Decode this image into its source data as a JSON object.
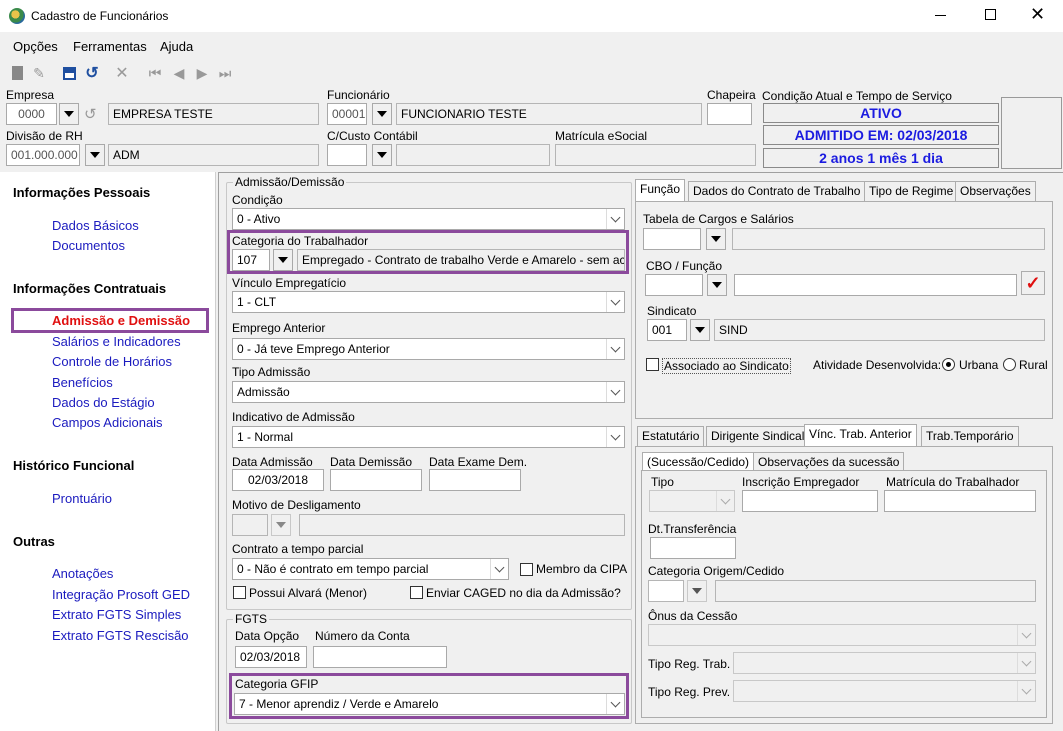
{
  "window": {
    "title": "Cadastro de Funcionários"
  },
  "menu": [
    "Opções",
    "Ferramentas",
    "Ajuda"
  ],
  "header": {
    "empresa_label": "Empresa",
    "empresa_code": "0000",
    "empresa_name": "EMPRESA TESTE",
    "funcionario_label": "Funcionário",
    "funcionario_code": "00001",
    "funcionario_name": "FUNCIONARIO TESTE",
    "chapeira_label": "Chapeira",
    "condicao_label": "Condição Atual e Tempo de Serviço",
    "status": "ATIVO",
    "admitido": "ADMITIDO EM: 02/03/2018",
    "tempo": "2 anos 1 mês 1 dia",
    "divisao_label": "Divisão de RH",
    "divisao_code": "001.000.000",
    "divisao_name": "ADM",
    "custo_label": "C/Custo Contábil",
    "matricula_label": "Matrícula eSocial"
  },
  "sidebar": {
    "sections": [
      {
        "title": "Informações Pessoais",
        "items": [
          "Dados Básicos",
          "Documentos"
        ]
      },
      {
        "title": "Informações Contratuais",
        "items": [
          "Admissão e Demissão",
          "Salários e Indicadores",
          "Controle de Horários",
          "Benefícios",
          "Dados do Estágio",
          "Campos Adicionais"
        ]
      },
      {
        "title": "Histórico Funcional",
        "items": [
          "Prontuário"
        ]
      },
      {
        "title": "Outras",
        "items": [
          "Anotações",
          "Integração Prosoft GED",
          "Extrato FGTS Simples",
          "Extrato FGTS Rescisão"
        ]
      }
    ],
    "active_color": "#e01010"
  },
  "adm": {
    "group": "Admissão/Demissão",
    "condicao_label": "Condição",
    "condicao": "0 - Ativo",
    "categoria_label": "Categoria do Trabalhador",
    "categoria_code": "107",
    "categoria_desc": "Empregado - Contrato de trabalho Verde e Amarelo - sem aco",
    "vinculo_label": "Vínculo Empregatício",
    "vinculo": "1 - CLT",
    "emprego_label": "Emprego Anterior",
    "emprego": "0 - Já teve Emprego Anterior",
    "tipo_label": "Tipo Admissão",
    "tipo": "Admissão",
    "indicativo_label": "Indicativo de Admissão",
    "indicativo": "1 - Normal",
    "data_adm_label": "Data Admissão",
    "data_adm": "02/03/2018",
    "data_dem_label": "Data Demissão",
    "data_exame_label": "Data Exame Dem.",
    "motivo_label": "Motivo de Desligamento",
    "contrato_label": "Contrato a tempo parcial",
    "contrato": "0 - Não é contrato em tempo parcial",
    "cipa": "Membro da CIPA",
    "alvara": "Possui Alvará (Menor)",
    "caged": "Enviar CAGED no dia da Admissão?"
  },
  "fgts": {
    "group": "FGTS",
    "data_opcao_label": "Data Opção",
    "data_opcao": "02/03/2018",
    "conta_label": "Número da Conta",
    "gfip_label": "Categoria GFIP",
    "gfip": "7 - Menor aprendiz / Verde e Amarelo"
  },
  "right_tabs": [
    "Função",
    "Dados do Contrato de Trabalho",
    "Tipo de Regime",
    "Observações"
  ],
  "funcao": {
    "tabela_label": "Tabela de Cargos e Salários",
    "cbo_label": "CBO / Função",
    "sindicato_label": "Sindicato",
    "sindicato_code": "001",
    "sindicato_name": "SIND",
    "associado": "Associado ao Sindicato",
    "atividade_label": "Atividade Desenvolvida:",
    "urbana": "Urbana",
    "rural": "Rural"
  },
  "lower_tabs": [
    "Estatutário",
    "Dirigente Sindical",
    "Vínc. Trab. Anterior",
    "Trab.Temporário"
  ],
  "sub_tabs": [
    "(Sucessão/Cedido)",
    "Observações da sucessão"
  ],
  "vinc": {
    "tipo_label": "Tipo",
    "inscricao_label": "Inscrição Empregador",
    "matricula_label": "Matrícula do Trabalhador",
    "dt_label": "Dt.Transferência",
    "categoria_label": "Categoria Origem/Cedido",
    "onus_label": "Ônus da Cessão",
    "reg_trab_label": "Tipo Reg. Trab.",
    "reg_prev_label": "Tipo Reg. Prev."
  }
}
